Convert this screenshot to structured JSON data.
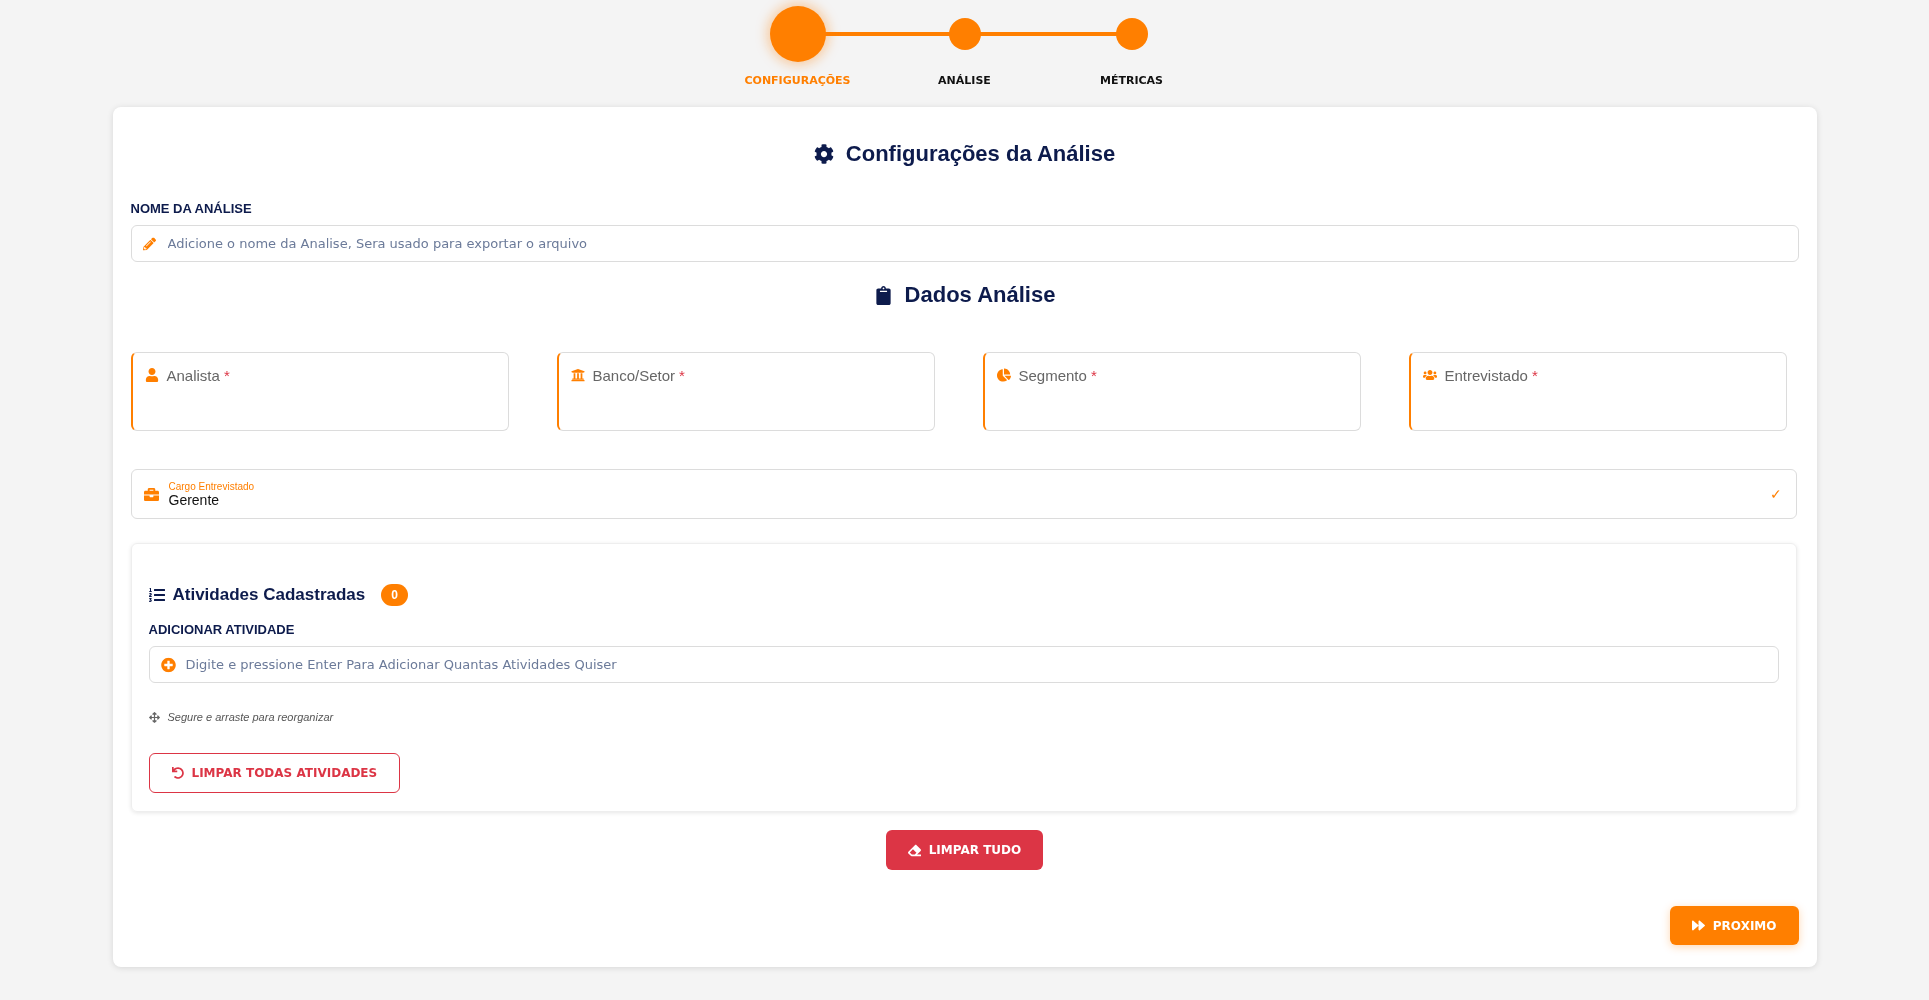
{
  "stepper": {
    "steps": [
      {
        "label": "CONFIGURAÇÕES",
        "selected": true
      },
      {
        "label": "ANÁLISE",
        "selected": false
      },
      {
        "label": "MÉTRICAS",
        "selected": false
      }
    ]
  },
  "config": {
    "title": "Configurações da Análise",
    "name_label": "NOME DA ANÁLISE",
    "name_field": {
      "placeholder": "Adicione o nome da Analise, Sera usado para exportar o arquivo"
    }
  },
  "dados": {
    "title": "Dados Análise",
    "fields": [
      {
        "label": "Analista",
        "required_mark": "*"
      },
      {
        "label": "Banco/Setor",
        "required_mark": "*"
      },
      {
        "label": "Segmento",
        "required_mark": "*"
      },
      {
        "label": "Entrevistado",
        "required_mark": "*"
      }
    ],
    "cargo": {
      "label": "Cargo Entrevistado",
      "value": "Gerente",
      "check": "✓"
    }
  },
  "atividades": {
    "title": "Atividades Cadastradas",
    "count": "0",
    "add_label": "ADICIONAR ATIVIDADE",
    "add_field": {
      "placeholder": "Digite e pressione Enter Para Adicionar Quantas Atividades Quiser"
    },
    "hint": "Segure e arraste para reorganizar",
    "clear_button": "LIMPAR TODAS ATIVIDADES"
  },
  "clear_all_button": "LIMPAR TUDO",
  "next_button": "PROXIMO"
}
